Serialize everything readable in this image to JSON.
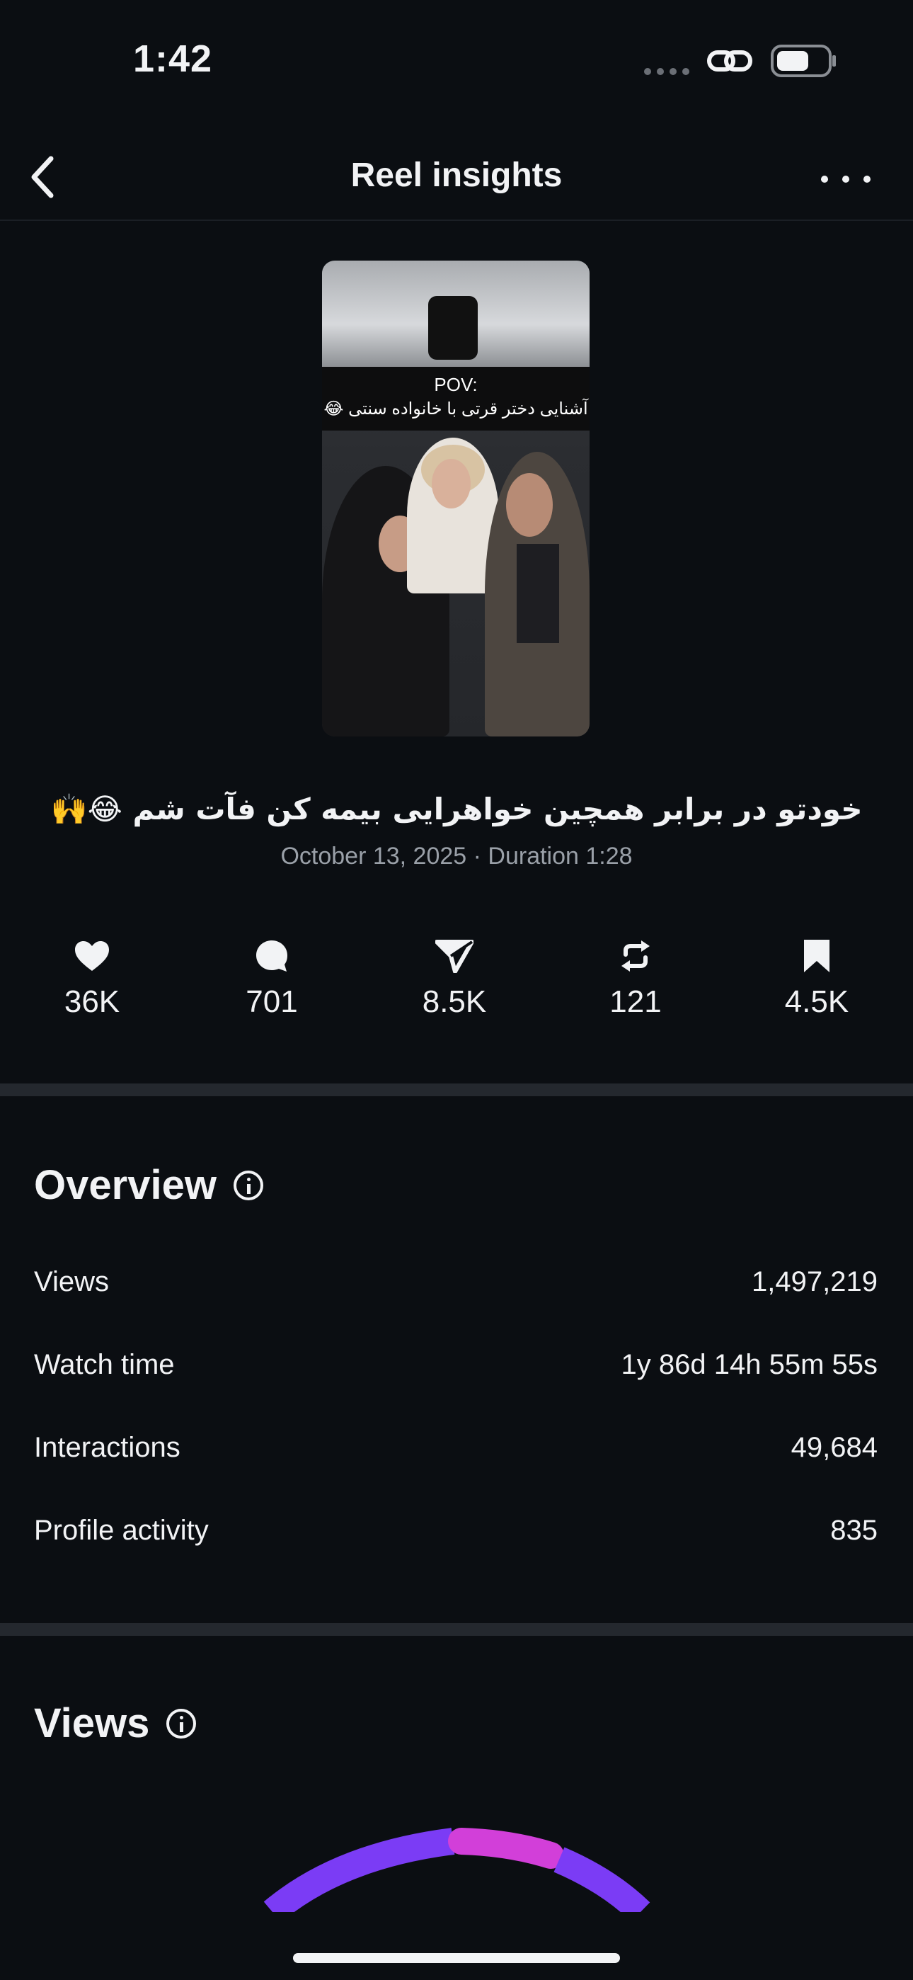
{
  "status_bar": {
    "time": "1:42"
  },
  "nav": {
    "title": "Reel insights"
  },
  "thumbnail": {
    "caption_line_1": "POV:",
    "caption_line_2": "آشنایی دختر قرتی با خانواده سنتی 😂"
  },
  "reel": {
    "caption": "خودتو در برابر همچین خواهرایی بیمه کن فآت شم 😂🙌",
    "meta": "October 13, 2025 · Duration 1:28"
  },
  "engagement": {
    "likes": "36K",
    "comments": "701",
    "shares": "8.5K",
    "reposts": "121",
    "saves": "4.5K"
  },
  "overview": {
    "title": "Overview",
    "rows": [
      {
        "label": "Views",
        "value": "1,497,219"
      },
      {
        "label": "Watch time",
        "value": "1y 86d 14h 55m 55s"
      },
      {
        "label": "Interactions",
        "value": "49,684"
      },
      {
        "label": "Profile activity",
        "value": "835"
      }
    ]
  },
  "views_section": {
    "title": "Views"
  },
  "colors": {
    "background": "#0b0e12",
    "accent_purple": "#7b3cf5",
    "accent_magenta": "#d23fd9"
  }
}
